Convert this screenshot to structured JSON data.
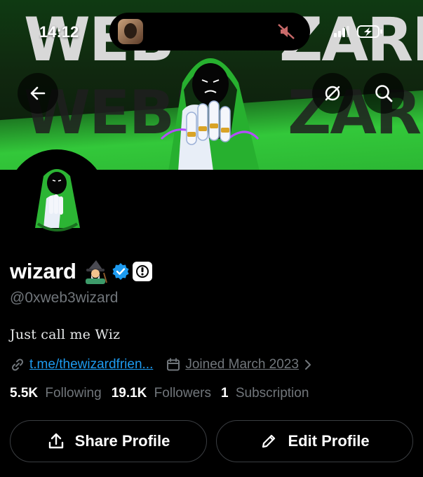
{
  "status_bar": {
    "time": "14:12"
  },
  "banner": {
    "word_top_left": "WEB",
    "word_top_right": "ZARD",
    "word_mid_left": "WEB3",
    "word_mid_right": "ZARD"
  },
  "profile": {
    "name": "wizard",
    "handle": "@0xweb3wizard",
    "bio": "Just call me Wiz",
    "link": "t.me/thewizardfrien...",
    "joined": "Joined March 2023"
  },
  "stats": {
    "following_count": "5.5K",
    "following_label": "Following",
    "followers_count": "19.1K",
    "followers_label": "Followers",
    "subscription_count": "1",
    "subscription_label": "Subscription"
  },
  "actions": {
    "share_label": "Share Profile",
    "edit_label": "Edit Profile"
  },
  "colors": {
    "accent": "#1d9bf0",
    "banner_green": "#33c83a",
    "muted_text": "#71767b"
  }
}
